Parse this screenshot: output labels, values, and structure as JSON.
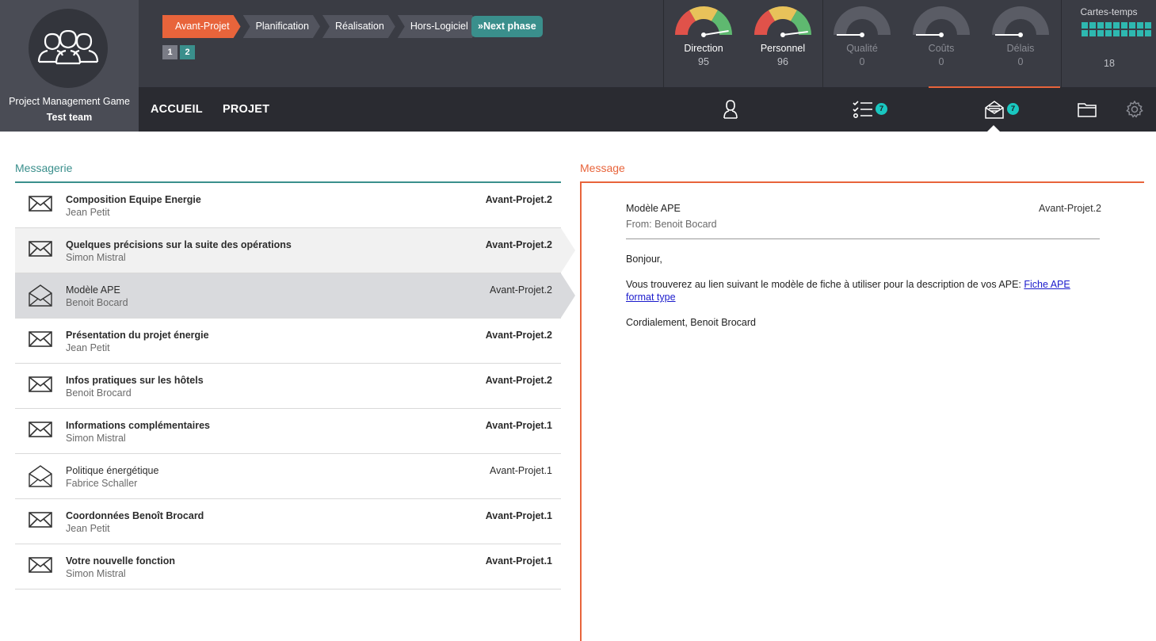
{
  "header": {
    "game_title": "Project Management Game",
    "team_name": "Test team",
    "phases": [
      {
        "label": "Avant-Projet",
        "active": true
      },
      {
        "label": "Planification",
        "active": false
      },
      {
        "label": "Réalisation",
        "active": false
      },
      {
        "label": "Hors-Logiciel",
        "active": false
      }
    ],
    "next_phase_label": "Next phase",
    "sub_steps": [
      "1",
      "2"
    ],
    "nav": {
      "home": "ACCUEIL",
      "project": "PROJET"
    },
    "gauges": [
      {
        "label": "Direction",
        "value": "95",
        "level": 95,
        "active": true
      },
      {
        "label": "Personnel",
        "value": "96",
        "level": 96,
        "active": true
      },
      {
        "label": "Qualité",
        "value": "0",
        "level": 0,
        "active": false
      },
      {
        "label": "Coûts",
        "value": "0",
        "level": 0,
        "active": false
      },
      {
        "label": "Délais",
        "value": "0",
        "level": 0,
        "active": false
      }
    ],
    "timecards": {
      "title": "Cartes-temps",
      "count": "18"
    },
    "toolbar": {
      "tasks_badge": "7",
      "messages_badge": "7"
    },
    "colors": {
      "accent": "#e8643b",
      "teal": "#3a8f8c",
      "badge": "#19c7c0"
    }
  },
  "messagerie": {
    "title": "Messagerie",
    "messages": [
      {
        "subject": "Composition Equipe Energie",
        "from": "Jean Petit",
        "phase": "Avant-Projet.2",
        "read": false
      },
      {
        "subject": "Quelques précisions sur la suite des opérations",
        "from": "Simon Mistral",
        "phase": "Avant-Projet.2",
        "read": false
      },
      {
        "subject": "Modèle APE",
        "from": "Benoit Bocard",
        "phase": "Avant-Projet.2",
        "read": true
      },
      {
        "subject": "Présentation du projet énergie",
        "from": "Jean Petit",
        "phase": "Avant-Projet.2",
        "read": false
      },
      {
        "subject": "Infos pratiques sur les hôtels",
        "from": "Benoit Brocard",
        "phase": "Avant-Projet.2",
        "read": false
      },
      {
        "subject": "Informations complémentaires",
        "from": "Simon Mistral",
        "phase": "Avant-Projet.1",
        "read": false
      },
      {
        "subject": "Politique énergétique",
        "from": "Fabrice Schaller",
        "phase": "Avant-Projet.1",
        "read": true
      },
      {
        "subject": "Coordonnées Benoît Brocard",
        "from": "Jean Petit",
        "phase": "Avant-Projet.1",
        "read": false
      },
      {
        "subject": "Votre nouvelle fonction",
        "from": "Simon Mistral",
        "phase": "Avant-Projet.1",
        "read": false
      }
    ]
  },
  "message": {
    "title": "Message",
    "subject": "Modèle APE",
    "phase": "Avant-Projet.2",
    "from": "From: Benoit Bocard",
    "greeting": "Bonjour,",
    "body_text": "Vous trouverez au lien suivant le modèle de fiche à utiliser pour la description de vos APE: ",
    "link_text": "Fiche APE format type",
    "signoff": "Cordialement, Benoit Brocard"
  }
}
